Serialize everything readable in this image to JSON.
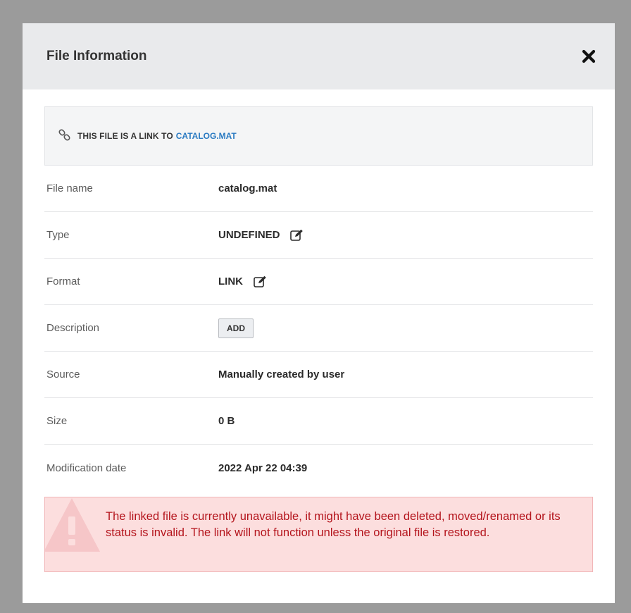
{
  "dialog": {
    "title": "File Information"
  },
  "link_banner": {
    "prefix": "THIS FILE IS A LINK TO",
    "target": "CATALOG.MAT"
  },
  "rows": {
    "file_name": {
      "label": "File name",
      "value": "catalog.mat"
    },
    "type": {
      "label": "Type",
      "value": "UNDEFINED"
    },
    "format": {
      "label": "Format",
      "value": "LINK"
    },
    "description": {
      "label": "Description",
      "button": "ADD"
    },
    "source": {
      "label": "Source",
      "value": "Manually created by user"
    },
    "size": {
      "label": "Size",
      "value": "0 B"
    },
    "modification_date": {
      "label": "Modification date",
      "value": "2022 Apr 22 04:39"
    }
  },
  "alert": {
    "message": "The linked file is currently unavailable, it might have been deleted, moved/renamed or its status is invalid. The link will not function unless the original file is restored."
  },
  "icons": {
    "close": "close-icon",
    "link": "link-icon",
    "edit": "edit-icon",
    "warning": "warning-icon"
  },
  "colors": {
    "overlay": "#9b9b9b",
    "header_bg": "#e9eaec",
    "link_accent": "#2a7ac2",
    "alert_bg": "#fcdede",
    "alert_text": "#b4141c"
  }
}
